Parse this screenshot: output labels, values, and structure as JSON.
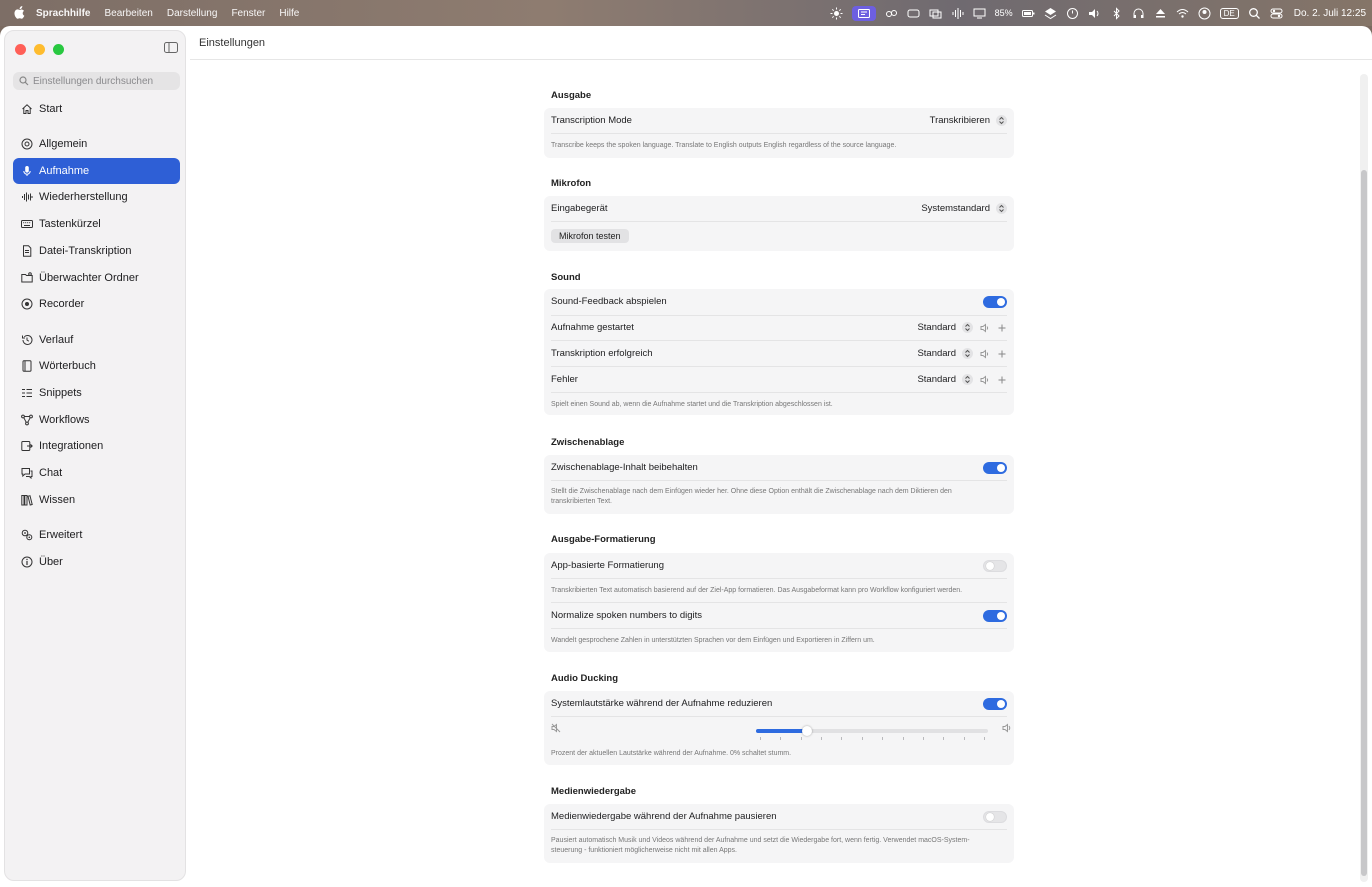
{
  "menubar": {
    "app": "Sprachhilfe",
    "items": [
      "Bearbeiten",
      "Darstellung",
      "Fenster",
      "Hilfe"
    ],
    "battery": "85%",
    "keyboard": "DE",
    "clock": "Do. 2. Juli  12:25"
  },
  "window": {
    "title": "Einstellungen"
  },
  "search": {
    "placeholder": "Einstellungen durchsuchen"
  },
  "sidebar": {
    "items": [
      {
        "label": "Start",
        "icon": "house-icon"
      },
      {
        "label": "Allgemein",
        "icon": "gear-circle-icon"
      },
      {
        "label": "Aufnahme",
        "icon": "microphone-icon",
        "active": true
      },
      {
        "label": "Wiederherstellung",
        "icon": "waveform-icon"
      },
      {
        "label": "Tastenkürzel",
        "icon": "keyboard-icon"
      },
      {
        "label": "Datei-Transkription",
        "icon": "document-icon"
      },
      {
        "label": "Überwachter Ordner",
        "icon": "folder-icon"
      },
      {
        "label": "Recorder",
        "icon": "record-icon"
      },
      {
        "label": "Verlauf",
        "icon": "history-icon"
      },
      {
        "label": "Wörterbuch",
        "icon": "book-icon"
      },
      {
        "label": "Snippets",
        "icon": "snippets-icon"
      },
      {
        "label": "Workflows",
        "icon": "workflow-icon"
      },
      {
        "label": "Integrationen",
        "icon": "integration-icon"
      },
      {
        "label": "Chat",
        "icon": "chat-icon"
      },
      {
        "label": "Wissen",
        "icon": "library-icon"
      },
      {
        "label": "Erweitert",
        "icon": "gears-icon"
      },
      {
        "label": "Über",
        "icon": "info-icon"
      }
    ]
  },
  "sections": {
    "ausgabe": {
      "title": "Ausgabe",
      "mode_label": "Transcription Mode",
      "mode_value": "Transkribieren",
      "desc": "Transcribe keeps the spoken language. Translate to English outputs English regardless of the source language."
    },
    "mikrofon": {
      "title": "Mikrofon",
      "device_label": "Eingabegerät",
      "device_value": "Systemstandard",
      "test_button": "Mikrofon testen"
    },
    "sound": {
      "title": "Sound",
      "feedback_label": "Sound-Feedback abspielen",
      "feedback_on": true,
      "rows": [
        {
          "label": "Aufnahme gestartet",
          "value": "Standard"
        },
        {
          "label": "Transkription erfolgreich",
          "value": "Standard"
        },
        {
          "label": "Fehler",
          "value": "Standard"
        }
      ],
      "desc": "Spielt einen Sound ab, wenn die Aufnahme startet und die Transkription abgeschlossen ist."
    },
    "zwischenablage": {
      "title": "Zwischenablage",
      "keep_label": "Zwischenablage-Inhalt beibehalten",
      "keep_on": true,
      "desc_line1": "Stellt die Zwischenablage nach dem Einfügen wieder her. Ohne diese Option enthält die Zwischenablage nach dem Diktieren den",
      "desc_line2": "transkribierten Text."
    },
    "formatierung": {
      "title": "Ausgabe-Formatierung",
      "app_label": "App-basierte Formatierung",
      "app_on": false,
      "app_desc": "Transkribierten Text automatisch basierend auf der Ziel-App formatieren. Das Ausgabeformat kann pro Workflow konfiguriert werden.",
      "numbers_label": "Normalize spoken numbers to digits",
      "numbers_on": true,
      "numbers_desc": "Wandelt gesprochene Zahlen in unterstützten Sprachen vor dem Einfügen und Exportieren in Ziffern um."
    },
    "ducking": {
      "title": "Audio Ducking",
      "reduce_label": "Systemlautstärke während der Aufnahme reduzieren",
      "reduce_on": true,
      "volume_fraction": 0.22,
      "desc": "Prozent der aktuellen Lautstärke während der Aufnahme. 0% schaltet stumm."
    },
    "medien": {
      "title": "Medienwiedergabe",
      "pause_label": "Medienwiedergabe während der Aufnahme pausieren",
      "pause_on": false,
      "desc_line1": "Pausiert automatisch Musik und Videos während der Aufnahme und setzt die Wiedergabe fort, wenn fertig. Verwendet macOS-System-",
      "desc_line2": "steuerung - funktioniert möglicherweise nicht mit allen Apps."
    }
  },
  "colors": {
    "accent": "#2e6be0",
    "sidebar_active": "#2e5fd6"
  }
}
